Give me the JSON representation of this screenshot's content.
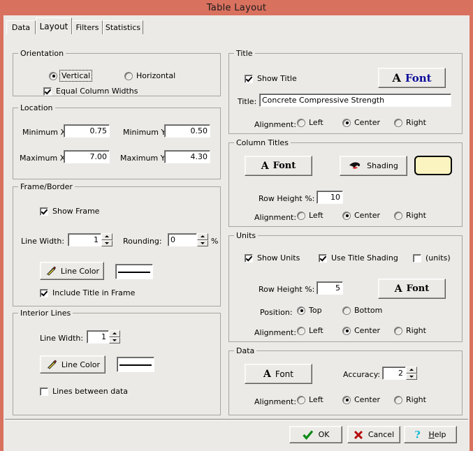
{
  "window": {
    "title": "Table Layout",
    "titlebar_color": "#d9715f",
    "face_color": "#eceae6"
  },
  "tabs": [
    {
      "label": "Data",
      "selected": false
    },
    {
      "label": "Layout",
      "selected": true
    },
    {
      "label": "Filters",
      "selected": false
    },
    {
      "label": "Statistics",
      "selected": false
    }
  ],
  "orientation": {
    "legend": "Orientation",
    "vertical": "Vertical",
    "horizontal": "Horizontal",
    "selected": "Vertical",
    "equal_column_widths": {
      "label": "Equal Column Widths",
      "checked": true
    }
  },
  "location": {
    "legend": "Location",
    "minimum_x": {
      "label": "Minimum X:",
      "value": "0.75"
    },
    "minimum_y": {
      "label": "Minimum Y:",
      "value": "0.50"
    },
    "maximum_x": {
      "label": "Maximum X:",
      "value": "7.00"
    },
    "maximum_y": {
      "label": "Maximum Y:",
      "value": "4.30"
    }
  },
  "frame_border": {
    "legend": "Frame/Border",
    "show_frame": {
      "label": "Show Frame",
      "checked": true
    },
    "line_width": {
      "label": "Line Width:",
      "value": "1"
    },
    "rounding": {
      "label": "Rounding:",
      "value": "0",
      "suffix": "%"
    },
    "line_color_button": "Line Color",
    "line_color_swatch": "#000000",
    "include_title_in_frame": {
      "label": "Include Title in Frame",
      "checked": true
    }
  },
  "interior_lines": {
    "legend": "Interior Lines",
    "line_width": {
      "label": "Line Width:",
      "value": "1"
    },
    "line_color_button": "Line Color",
    "line_color_swatch": "#000000",
    "lines_between_data": {
      "label": "Lines between data",
      "checked": false
    }
  },
  "title": {
    "legend": "Title",
    "show_title": {
      "label": "Show Title",
      "checked": true
    },
    "font_button": {
      "a": "A",
      "label": "Font"
    },
    "title_label": "Title:",
    "title_value": "Concrete Compressive Strength",
    "alignment_label": "Alignment:",
    "alignment_options": [
      "Left",
      "Center",
      "Right"
    ],
    "alignment_selected": "Center"
  },
  "column_titles": {
    "legend": "Column Titles",
    "font_button": {
      "a": "A",
      "label": "Font"
    },
    "shading_button": "Shading",
    "shading_swatch": "#fbf4c0",
    "row_height": {
      "label": "Row Height %:",
      "value": "10"
    },
    "alignment_label": "Alignment:",
    "alignment_options": [
      "Left",
      "Center",
      "Right"
    ],
    "alignment_selected": "Center"
  },
  "units": {
    "legend": "Units",
    "show_units": {
      "label": "Show Units",
      "checked": true
    },
    "use_title_shading": {
      "label": "Use Title Shading",
      "checked": true
    },
    "units_paren": {
      "label": "(units)",
      "checked": false
    },
    "row_height": {
      "label": "Row Height %:",
      "value": "5"
    },
    "font_button": {
      "a": "A",
      "label": "Font"
    },
    "position_label": "Position:",
    "position_options": [
      "Top",
      "Bottom"
    ],
    "position_selected": "Top",
    "alignment_label": "Alignment:",
    "alignment_options": [
      "Left",
      "Center",
      "Right"
    ],
    "alignment_selected": "Center"
  },
  "data_group": {
    "legend": "Data",
    "font_button": {
      "a": "A",
      "label": "Font"
    },
    "accuracy": {
      "label": "Accuracy:",
      "value": "2"
    },
    "alignment_label": "Alignment:",
    "alignment_options": [
      "Left",
      "Center",
      "Right"
    ],
    "alignment_selected": "Center"
  },
  "footer": {
    "ok": "OK",
    "cancel": "Cancel",
    "help_pre": "H",
    "help_post": "elp"
  }
}
